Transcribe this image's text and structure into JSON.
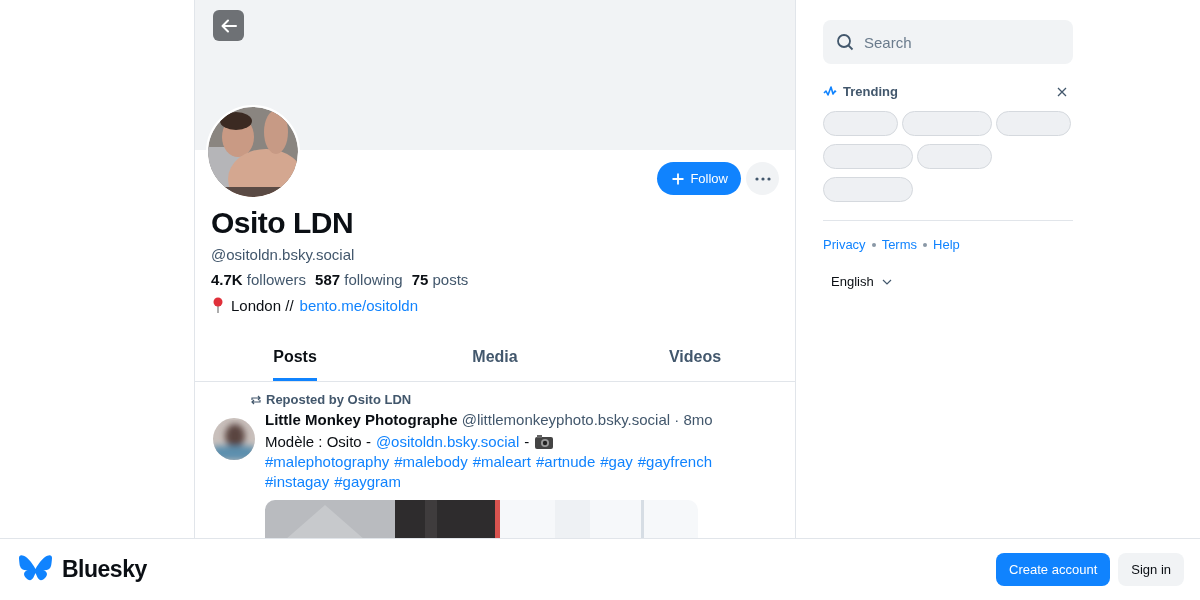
{
  "profile": {
    "name": "Osito LDN",
    "handle": "@ositoldn.bsky.social",
    "stats": [
      {
        "count": "4.7K",
        "label": "followers"
      },
      {
        "count": "587",
        "label": "following"
      },
      {
        "count": "75",
        "label": "posts"
      }
    ],
    "bio_text": "London //",
    "bio_link": "bento.me/ositoldn",
    "follow_label": "Follow"
  },
  "tabs": [
    {
      "label": "Posts",
      "selected": true
    },
    {
      "label": "Media",
      "selected": false
    },
    {
      "label": "Videos",
      "selected": false
    }
  ],
  "post": {
    "repost_label": "Reposted by Osito LDN",
    "author": "Little Monkey Photographe",
    "author_handle": "@littlemonkeyphoto.bsky.social · 8mo",
    "text_before": "Modèle : Osito -",
    "mention": "@ositoldn.bsky.social",
    "text_after": "-",
    "hashtags": [
      "#malephotography",
      "#malebody",
      "#maleart",
      "#artnude",
      "#gay",
      "#gayfrench",
      "#instagay",
      "#gaygram"
    ]
  },
  "sidebar": {
    "search": {
      "placeholder": "Search"
    },
    "trending_title": "Trending",
    "footer_links": [
      "Privacy",
      "Terms",
      "Help"
    ],
    "language": "English"
  },
  "bottom_bar": {
    "brand": "Bluesky",
    "buttons": [
      {
        "label": "Create account",
        "kind": "primary"
      },
      {
        "label": "Sign in",
        "kind": "secondary"
      }
    ]
  }
}
